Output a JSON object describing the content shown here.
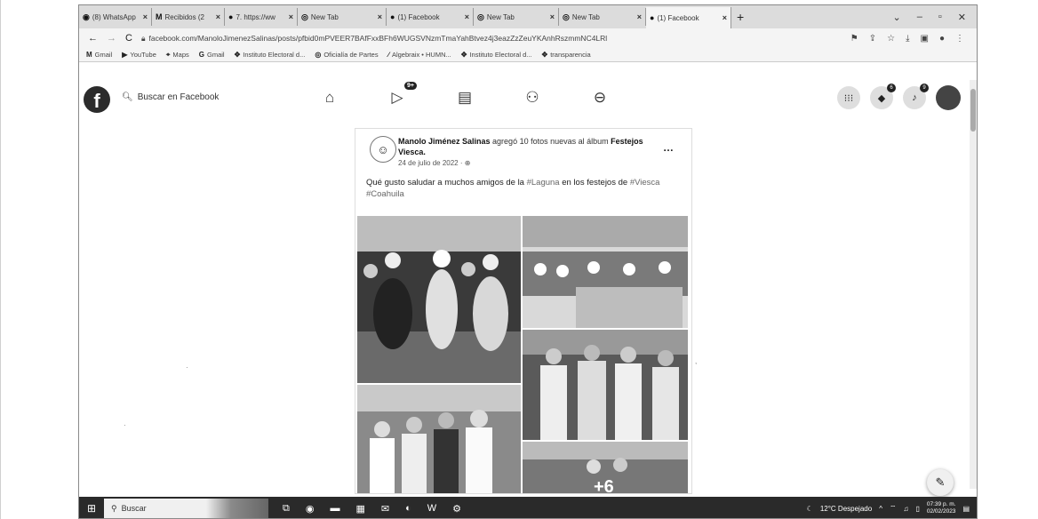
{
  "browser": {
    "tabs": [
      {
        "label": "(8) WhatsApp",
        "icon": "whatsapp-icon",
        "active": false
      },
      {
        "label": "Recibidos (2",
        "icon": "gmail-icon",
        "active": false
      },
      {
        "label": "7. https://ww",
        "icon": "facebook-icon",
        "active": false
      },
      {
        "label": "New Tab",
        "icon": "chrome-icon",
        "active": false
      },
      {
        "label": "(1) Facebook",
        "icon": "facebook-icon",
        "active": false
      },
      {
        "label": "New Tab",
        "icon": "chrome-icon",
        "active": false
      },
      {
        "label": "New Tab",
        "icon": "chrome-icon",
        "active": false
      },
      {
        "label": "(1) Facebook",
        "icon": "facebook-icon",
        "active": true
      }
    ],
    "url": "facebook.com/ManoloJimenezSalinas/posts/pfbid0mPVEER7BAfFxxBFh6WUGSVNzmTmaYahBtvez4j3eazZzZeuYKAnhRszmmNC4LRl",
    "bookmarks": [
      {
        "label": "Gmail",
        "icon": "gmail-icon"
      },
      {
        "label": "YouTube",
        "icon": "youtube-icon"
      },
      {
        "label": "Maps",
        "icon": "maps-icon"
      },
      {
        "label": "Gmail",
        "icon": "google-icon"
      },
      {
        "label": "Instituto Electoral d...",
        "icon": "ine-icon"
      },
      {
        "label": "Oficialía de Partes",
        "icon": "chrome-icon"
      },
      {
        "label": "Algebraix • HUMN...",
        "icon": "algebraix-icon"
      },
      {
        "label": "Instituto Electoral d...",
        "icon": "ine-icon"
      },
      {
        "label": "transparencia",
        "icon": "ine-icon"
      }
    ]
  },
  "facebook": {
    "search_placeholder": "Buscar en Facebook",
    "watch_badge": "9+",
    "messenger_badge": "6",
    "notifications_badge": "9"
  },
  "post": {
    "author": "Manolo Jiménez Salinas",
    "action": "agregó 10 fotos nuevas al álbum",
    "album": "Festejos Viesca.",
    "date": "24 de julio de 2022 · ",
    "text_main": "Qué gusto saludar a muchos amigos de la ",
    "hashtag_laguna": "#Laguna",
    "text_mid": " en los festejos de ",
    "hashtag_viesca": "#Viesca",
    "hashtag_coahuila": "#Coahuila",
    "more_photos": "+6"
  },
  "taskbar": {
    "search_label": "Buscar",
    "weather": "12°C Despejado",
    "time": "07:39 p. m.",
    "date": "02/02/2023"
  }
}
